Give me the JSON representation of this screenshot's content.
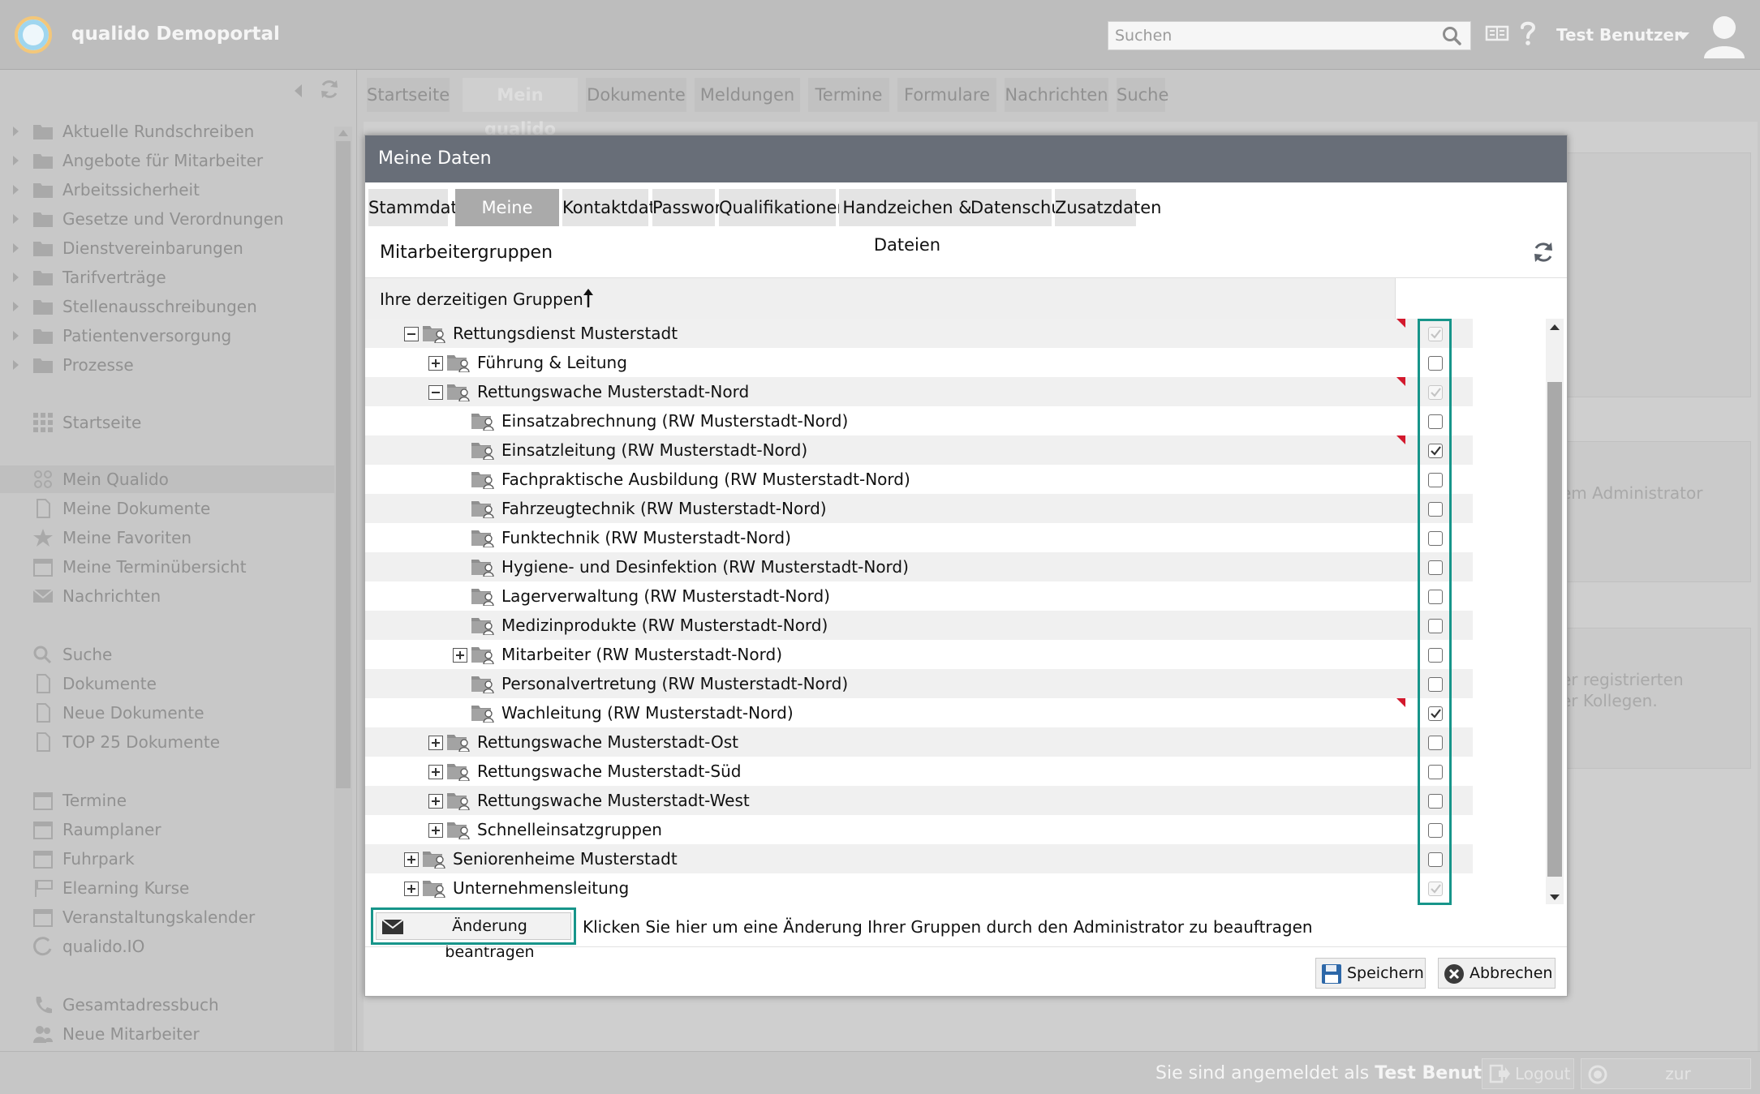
{
  "app": {
    "title": "qualido Demoportal",
    "search_placeholder": "Suchen",
    "user_name": "Test Benutzer"
  },
  "main_tabs": [
    {
      "label": "Startseite",
      "active": false
    },
    {
      "label": "Mein qualido",
      "active": true
    },
    {
      "label": "Dokumente",
      "active": false
    },
    {
      "label": "Meldungen",
      "active": false
    },
    {
      "label": "Termine",
      "active": false
    },
    {
      "label": "Formulare",
      "active": false
    },
    {
      "label": "Nachrichten",
      "active": false
    },
    {
      "label": "Suche",
      "active": false
    }
  ],
  "sidebar": {
    "folders": [
      "Aktuelle Rundschreiben",
      "Angebote für Mitarbeiter",
      "Arbeitssicherheit",
      "Gesetze und Verordnungen",
      "Dienstvereinbarungen",
      "Tarifverträge",
      "Stellenausschreibungen",
      "Patientenversorgung",
      "Prozesse"
    ],
    "startseite": "Startseite",
    "personal": [
      "Mein Qualido",
      "Meine Dokumente",
      "Meine Favoriten",
      "Meine Terminübersicht",
      "Nachrichten"
    ],
    "search_items": [
      "Suche",
      "Dokumente",
      "Neue Dokumente",
      "TOP 25 Dokumente"
    ],
    "calendar_items": [
      "Termine",
      "Raumplaner",
      "Fuhrpark",
      "Elearning Kurse",
      "Veranstaltungskalender",
      "qualido.IO"
    ],
    "contact_items": [
      "Gesamtadressbuch",
      "Neue Mitarbeiter"
    ]
  },
  "background_fragments": [
    "em Administrator",
    "er registrierten",
    "er Kollegen."
  ],
  "modal": {
    "title": "Meine Daten",
    "tabs": [
      {
        "label": "Stammdaten",
        "active": false
      },
      {
        "label": "Meine Gruppe/n",
        "active": true
      },
      {
        "label": "Kontaktdaten",
        "active": false
      },
      {
        "label": "Passwort",
        "active": false
      },
      {
        "label": "Qualifikationen",
        "active": false
      },
      {
        "label": "Handzeichen & Dateien",
        "active": false
      },
      {
        "label": "Datenschutz",
        "active": false
      },
      {
        "label": "Zusatzdaten",
        "active": false
      }
    ],
    "section_title": "Mitarbeitergruppen",
    "column_header": "Ihre derzeitigen Gruppen",
    "tree": [
      {
        "label": "Rettungsdienst Musterstadt",
        "level": 0,
        "toggle": "minus",
        "checked": true,
        "disabled": true,
        "flag": true
      },
      {
        "label": "Führung & Leitung",
        "level": 1,
        "toggle": "plus",
        "checked": false,
        "disabled": false,
        "flag": false
      },
      {
        "label": "Rettungswache Musterstadt-Nord",
        "level": 1,
        "toggle": "minus",
        "checked": true,
        "disabled": true,
        "flag": true
      },
      {
        "label": "Einsatzabrechnung (RW Musterstadt-Nord)",
        "level": 2,
        "toggle": "none",
        "checked": false,
        "disabled": false,
        "flag": false
      },
      {
        "label": "Einsatzleitung (RW Musterstadt-Nord)",
        "level": 2,
        "toggle": "none",
        "checked": true,
        "disabled": false,
        "flag": true
      },
      {
        "label": "Fachpraktische Ausbildung (RW Musterstadt-Nord)",
        "level": 2,
        "toggle": "none",
        "checked": false,
        "disabled": false,
        "flag": false
      },
      {
        "label": "Fahrzeugtechnik (RW Musterstadt-Nord)",
        "level": 2,
        "toggle": "none",
        "checked": false,
        "disabled": false,
        "flag": false
      },
      {
        "label": "Funktechnik (RW Musterstadt-Nord)",
        "level": 2,
        "toggle": "none",
        "checked": false,
        "disabled": false,
        "flag": false
      },
      {
        "label": "Hygiene- und Desinfektion (RW Musterstadt-Nord)",
        "level": 2,
        "toggle": "none",
        "checked": false,
        "disabled": false,
        "flag": false
      },
      {
        "label": "Lagerverwaltung (RW Musterstadt-Nord)",
        "level": 2,
        "toggle": "none",
        "checked": false,
        "disabled": false,
        "flag": false
      },
      {
        "label": "Medizinprodukte (RW Musterstadt-Nord)",
        "level": 2,
        "toggle": "none",
        "checked": false,
        "disabled": false,
        "flag": false
      },
      {
        "label": "Mitarbeiter (RW Musterstadt-Nord)",
        "level": 2,
        "toggle": "plus",
        "checked": false,
        "disabled": false,
        "flag": false
      },
      {
        "label": "Personalvertretung (RW Musterstadt-Nord)",
        "level": 2,
        "toggle": "none",
        "checked": false,
        "disabled": false,
        "flag": false
      },
      {
        "label": "Wachleitung (RW Musterstadt-Nord)",
        "level": 2,
        "toggle": "none",
        "checked": true,
        "disabled": false,
        "flag": true
      },
      {
        "label": "Rettungswache Musterstadt-Ost",
        "level": 1,
        "toggle": "plus",
        "checked": false,
        "disabled": false,
        "flag": false
      },
      {
        "label": "Rettungswache Musterstadt-Süd",
        "level": 1,
        "toggle": "plus",
        "checked": false,
        "disabled": false,
        "flag": false
      },
      {
        "label": "Rettungswache Musterstadt-West",
        "level": 1,
        "toggle": "plus",
        "checked": false,
        "disabled": false,
        "flag": false
      },
      {
        "label": "Schnelleinsatzgruppen",
        "level": 1,
        "toggle": "plus",
        "checked": false,
        "disabled": false,
        "flag": false
      },
      {
        "label": "Seniorenheime Musterstadt",
        "level": 0,
        "toggle": "plus",
        "checked": false,
        "disabled": false,
        "flag": false
      },
      {
        "label": "Unternehmensleitung",
        "level": 0,
        "toggle": "plus",
        "checked": true,
        "disabled": true,
        "flag": false
      }
    ],
    "request_button": "Änderung beantragen",
    "request_hint": "Klicken Sie hier um eine Änderung Ihrer Gruppen durch den Administrator zu beauftragen",
    "save_button": "Speichern",
    "cancel_button": "Abbrechen"
  },
  "footer": {
    "logged_in_prefix": "Sie sind angemeldet als",
    "logged_in_user": "Test Benutzer",
    "logout_button": "Logout",
    "admin_button": "zur Administration"
  },
  "colors": {
    "accent_teal": "#17958a",
    "modal_header": "#686e78",
    "flag_red": "#d3192d"
  }
}
